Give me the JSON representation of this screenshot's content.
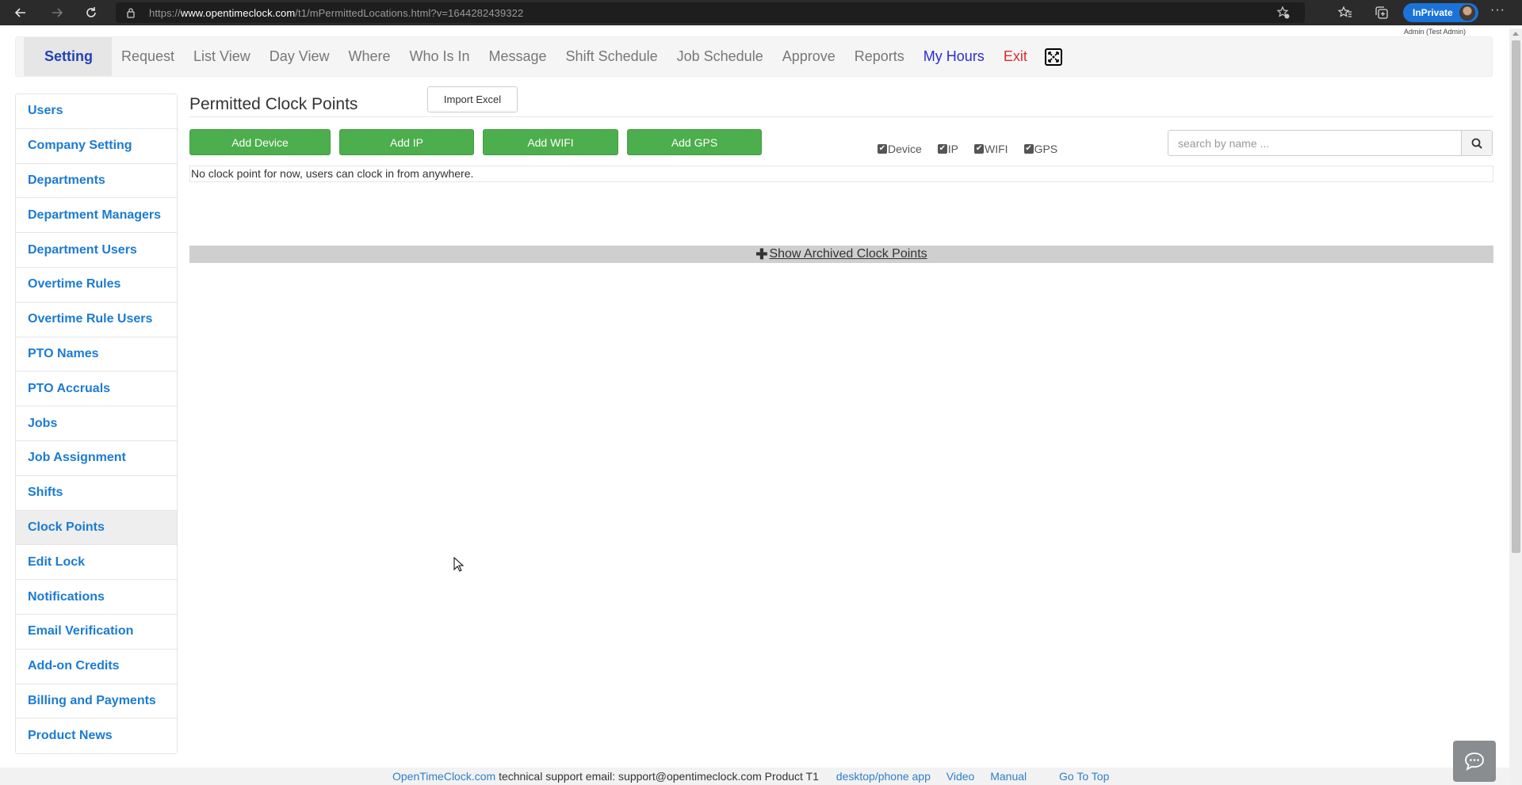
{
  "browser": {
    "url_prefix": "https://",
    "url_domain": "www.opentimeclock.com",
    "url_path": "/t1/mPermittedLocations.html?v=1644282439322",
    "inprivate_label": "InPrivate",
    "more_label": "···"
  },
  "user": {
    "admin_label": "Admin (Test Admin)"
  },
  "topnav": {
    "items": [
      {
        "label": "Setting",
        "state": "active"
      },
      {
        "label": "Request"
      },
      {
        "label": "List View"
      },
      {
        "label": "Day View"
      },
      {
        "label": "Where"
      },
      {
        "label": "Who Is In"
      },
      {
        "label": "Message"
      },
      {
        "label": "Shift Schedule"
      },
      {
        "label": "Job Schedule"
      },
      {
        "label": "Approve"
      },
      {
        "label": "Reports"
      },
      {
        "label": "My Hours",
        "color": "#2d2ccf"
      },
      {
        "label": "Exit",
        "color": "#e02a2a"
      }
    ]
  },
  "sidebar": {
    "items": [
      {
        "label": "Users"
      },
      {
        "label": "Company Setting"
      },
      {
        "label": "Departments"
      },
      {
        "label": "Department Managers"
      },
      {
        "label": "Department Users"
      },
      {
        "label": "Overtime Rules"
      },
      {
        "label": "Overtime Rule Users"
      },
      {
        "label": "PTO Names"
      },
      {
        "label": "PTO Accruals"
      },
      {
        "label": "Jobs"
      },
      {
        "label": "Job Assignment"
      },
      {
        "label": "Shifts"
      },
      {
        "label": "Clock Points",
        "active": true
      },
      {
        "label": "Edit Lock"
      },
      {
        "label": "Notifications"
      },
      {
        "label": "Email Verification"
      },
      {
        "label": "Add-on Credits"
      },
      {
        "label": "Billing and Payments"
      },
      {
        "label": "Product News"
      }
    ]
  },
  "main": {
    "title": "Permitted Clock Points",
    "import_excel_label": "Import Excel",
    "buttons": {
      "add_device": "Add Device",
      "add_ip": "Add IP",
      "add_wifi": "Add WIFI",
      "add_gps": "Add GPS"
    },
    "filters": [
      {
        "label": "Device",
        "checked": true
      },
      {
        "label": "IP",
        "checked": true
      },
      {
        "label": "WIFI",
        "checked": true
      },
      {
        "label": "GPS",
        "checked": true
      }
    ],
    "search_placeholder": "search by name ...",
    "empty_message": "No clock point for now, users can clock in from anywhere.",
    "archived_label": " Show Archived Clock Points"
  },
  "footer": {
    "brand_link": "OpenTimeClock.com",
    "support_text": " technical support email: support@opentimeclock.com Product T1",
    "app_link": "desktop/phone app",
    "video_link": "Video",
    "manual_link": "Manual",
    "top_link": "Go To Top"
  },
  "colors": {
    "accent_green": "#4cae4c",
    "link_blue": "#1b7bd2",
    "active_nav": "#2340b9"
  }
}
